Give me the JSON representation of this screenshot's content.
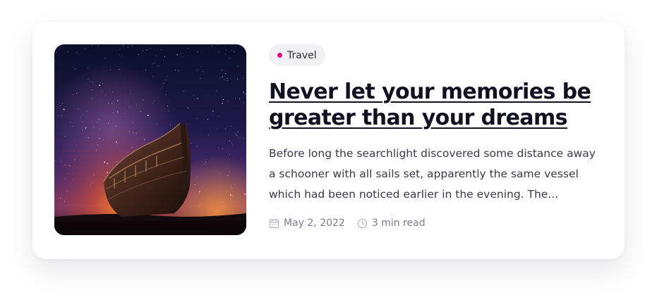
{
  "post": {
    "image_alt": "Wooden boat under a starry night sky",
    "category": {
      "label": "Travel",
      "dot_color": "#e5097f"
    },
    "title": "Never let your memories be greater than your dreams",
    "excerpt": "Before long the searchlight discovered some distance away a schooner with all sails set, apparently the same vessel which had been noticed earlier in the evening. The...",
    "meta": {
      "date": "May 2, 2022",
      "date_icon": "calendar-icon",
      "read_time": "3 min read",
      "read_time_icon": "clock-icon"
    }
  }
}
